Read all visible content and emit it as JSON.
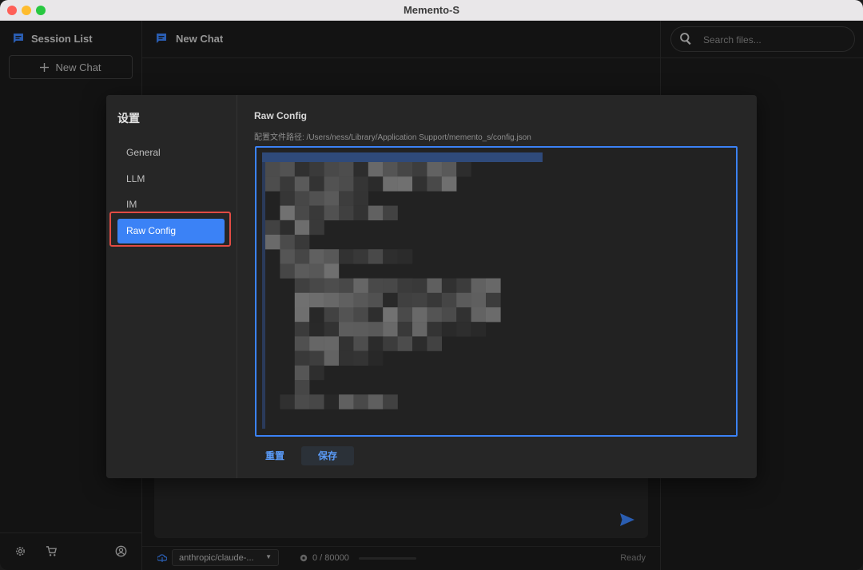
{
  "window": {
    "title": "Memento-S"
  },
  "sidebar": {
    "title": "Session List",
    "new_chat_label": "New Chat"
  },
  "main": {
    "header_title": "New Chat"
  },
  "right_panel": {
    "search_placeholder": "Search files..."
  },
  "status_bar": {
    "model": "anthropic/claude-...",
    "tokens": "0 / 80000",
    "token_usage_fraction": 0,
    "status": "Ready"
  },
  "dialog": {
    "title": "设置",
    "nav": [
      {
        "label": "General",
        "active": false
      },
      {
        "label": "LLM",
        "active": false
      },
      {
        "label": "IM",
        "active": false
      },
      {
        "label": "Raw Config",
        "active": true
      }
    ],
    "content": {
      "heading": "Raw Config",
      "path_label": "配置文件路径: /Users/ness/Library/Application Support/memento_s/config.json",
      "reset_label": "重置",
      "save_label": "保存"
    }
  },
  "colors": {
    "accent": "#3b82f6",
    "highlight": "#e24b43",
    "background": "#1b1b1b",
    "dialog": "#262626"
  },
  "icons": {
    "session": "chat-bubble-icon",
    "new_chat": "plus-icon",
    "settings": "gear-icon",
    "store": "cart-icon",
    "account": "user-circle-icon",
    "search": "search-icon",
    "send": "send-icon",
    "model": "cloud-icon",
    "tokens": "token-icon"
  }
}
